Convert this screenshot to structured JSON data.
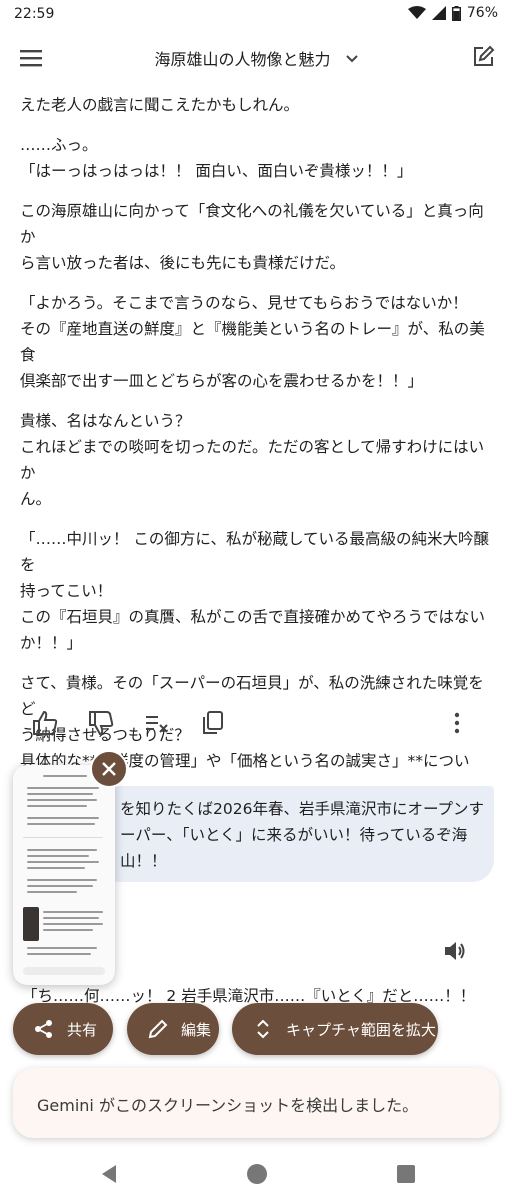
{
  "status_bar": {
    "time": "22:59",
    "battery": "76%"
  },
  "header": {
    "title": "海原雄山の人物像と魅力"
  },
  "messages": {
    "paragraphs": [
      "えた老人の戯言に聞こえたかもしれん。",
      "……ふっ。\n「はーっはっはっは！！ 面白い、面白いぞ貴様ッ！！」",
      "この海原雄山に向かって「食文化への礼儀を欠いている」と真っ向か\nら言い放った者は、後にも先にも貴様だけだ。",
      "「よかろう。そこまで言うのなら、見せてもらおうではないか！\nその『産地直送の鮮度』と『機能美という名のトレー』が、私の美食\n倶楽部で出す一皿とどちらが客の心を震わせるかを！！」",
      "貴様、名はなんという？\nこれほどまでの啖呵を切ったのだ。ただの客として帰すわけにはいか\nん。",
      "「……中川ッ！ この御方に、私が秘蔵している最高級の純米大吟醸を\n持ってこい！\nこの『石垣貝』の真贋、私がこの舌で直接確かめてやろうではない\nか！！」",
      "さて、貴様。その「スーパーの石垣貝」が、私の洗練された味覚をど\nう納得させるつもりだ？\n具体的な**「鮮度の管理」や「価格という名の誠実さ」**について、\n私を論破してみせろ！"
    ],
    "user_message": "を知りたくば2026年春、岩手県滝沢市にオープンす\n ーパー、「いとく」に来るがいい！待っているぞ海\n 山！！",
    "partial_line": "「ち……何……ッ！ 2 岩手県滝沢市……『いとく』だと……！！"
  },
  "screenshot_tools": {
    "share_label": "共有",
    "edit_label": "編集",
    "expand_label": "キャプチャ範囲を拡大",
    "toast": "Gemini がこのスクリーンショットを検出しました。"
  },
  "icons": {
    "menu": "menu-icon",
    "dropdown": "chevron-down-icon",
    "compose": "edit-square-icon",
    "like": "thumb-up-icon",
    "dislike": "thumb-down-icon",
    "modify": "tune-icon",
    "copy": "copy-icon",
    "more": "more-vert-icon",
    "speaker": "volume-icon",
    "close": "close-icon",
    "share": "share-icon",
    "edit": "pencil-icon",
    "expand": "expand-vertical-icon"
  },
  "colors": {
    "accent_brown": "#6b4e3b",
    "user_bubble": "#e9eef6",
    "toast_bg": "#fdf6f2"
  }
}
